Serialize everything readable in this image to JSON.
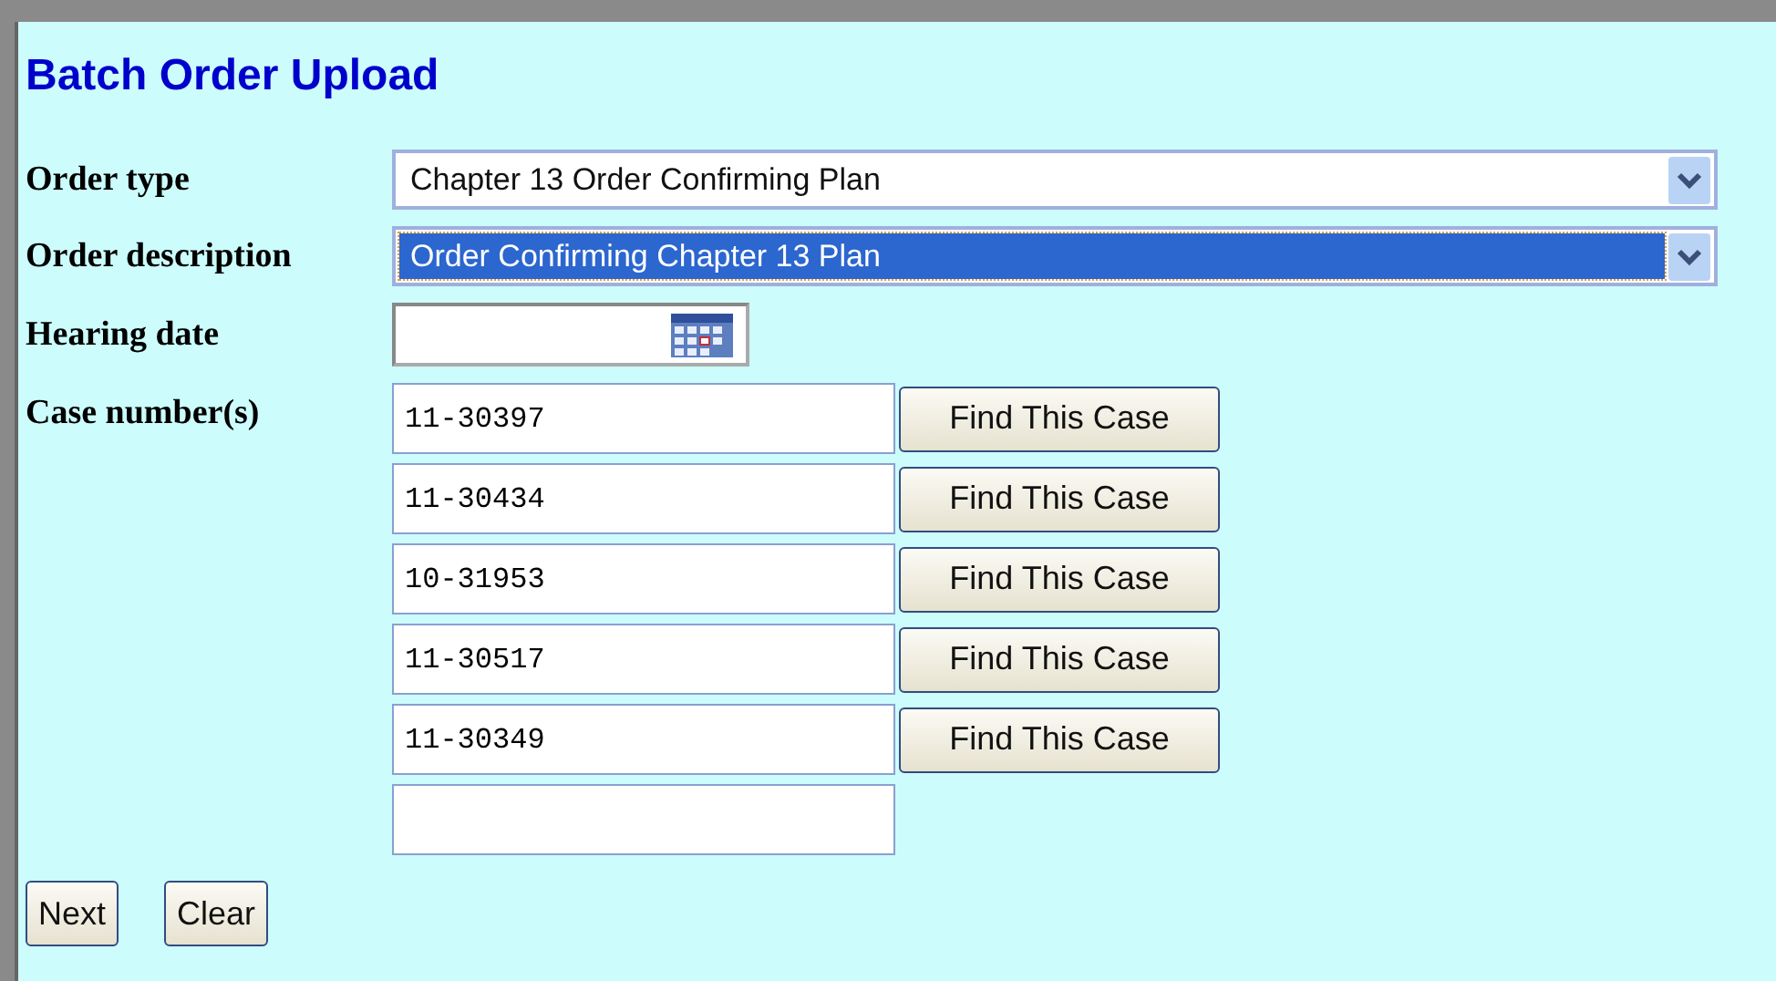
{
  "title": "Batch Order Upload",
  "fields": [
    {
      "kind": "select",
      "label": "Order type",
      "value": "Chapter 13 Order Confirming Plan",
      "focused": false
    },
    {
      "kind": "select",
      "label": "Order description",
      "value": "Order Confirming Chapter 13 Plan",
      "focused": true
    },
    {
      "kind": "date",
      "label": "Hearing date"
    }
  ],
  "cases": {
    "label": "Case number(s)",
    "rows": [
      {
        "value": "11-30397",
        "button": "Find This Case"
      },
      {
        "value": "11-30434",
        "button": "Find This Case"
      },
      {
        "value": "10-31953",
        "button": "Find This Case"
      },
      {
        "value": "11-30517",
        "button": "Find This Case"
      },
      {
        "value": "11-30349",
        "button": "Find This Case"
      },
      {}
    ]
  },
  "buttons": [
    "Next",
    "Clear"
  ]
}
